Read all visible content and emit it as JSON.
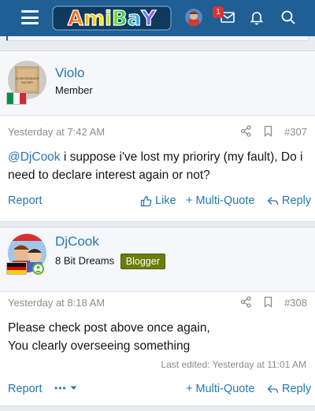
{
  "nav": {
    "logo_text": "AmiBaY",
    "notification_count": "1",
    "icons": [
      "menu-icon",
      "inbox-icon",
      "bell-icon",
      "search-icon"
    ]
  },
  "posts": [
    {
      "username": "Violo",
      "user_title": "Member",
      "flag": "italy",
      "avatar_caption": "SCHROEDINGER BACKER",
      "date": "Yesterday at 7:42 AM",
      "number": "#307",
      "mention": "@DjCook",
      "body": " i suppose i've lost my prioriry (my fault), Do i need to declare interest again or not?",
      "actions": {
        "report": "Report",
        "like": "Like",
        "multiquote": "+ Multi-Quote",
        "reply": "Reply"
      }
    },
    {
      "username": "DjCook",
      "user_title": "8 Bit Dreams",
      "badge": "Blogger",
      "flag": "germany",
      "date": "Yesterday at 8:18 AM",
      "number": "#308",
      "body_line1": "Please check post above once again,",
      "body_line2": "You clearly overseeing something",
      "edited": "Last edited: Yesterday at 11:01 AM",
      "actions": {
        "report": "Report",
        "more": "•••",
        "multiquote": "+ Multi-Quote",
        "reply": "Reply"
      }
    }
  ],
  "colors": {
    "nav_bg": "#1f5f94",
    "link": "#2577b1",
    "page_bg": "#e9edf1",
    "header_bg": "#f5f7fa",
    "badge_blogger": "#6b7d0c",
    "notification_badge": "#e03030"
  }
}
